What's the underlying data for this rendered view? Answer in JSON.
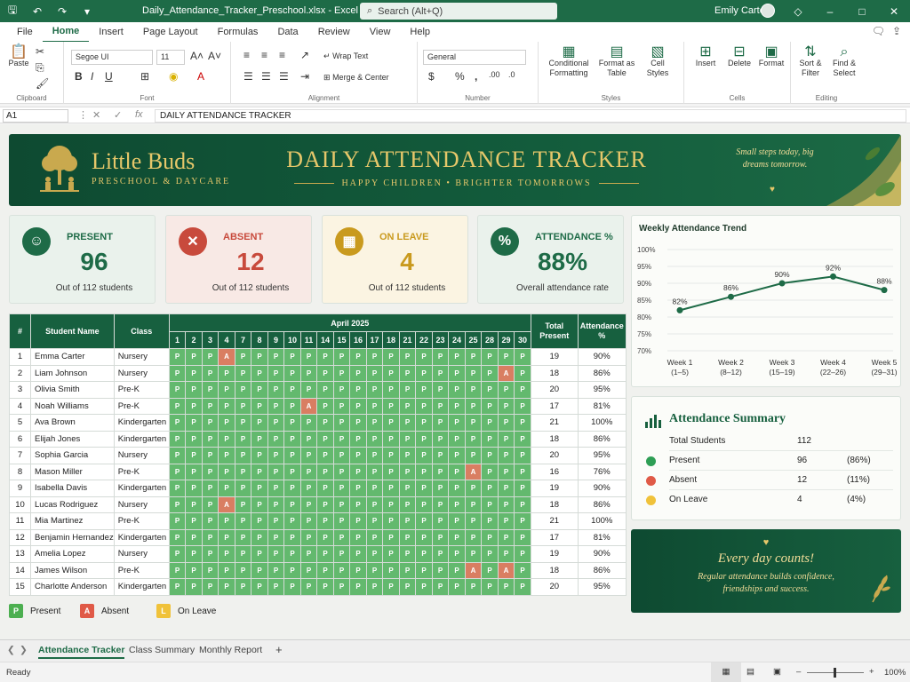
{
  "titlebar": {
    "filename": "Daily_Attendance_Tracker_Preschool.xlsx",
    "app_suffix": "- Excel",
    "search_placeholder": "Search (Alt+Q)",
    "user": "Emily Carter"
  },
  "menu": [
    "File",
    "Home",
    "Insert",
    "Page Layout",
    "Formulas",
    "Data",
    "Review",
    "View",
    "Help"
  ],
  "ribbon": {
    "paste": "Paste",
    "clipboard": "Clipboard",
    "font_name": "Segoe UI",
    "font_size": "11",
    "font": "Font",
    "wrap_text": "Wrap Text",
    "merge_center": "Merge & Center",
    "alignment": "Alignment",
    "number_format": "General",
    "number": "Number",
    "conditional_formatting": "Conditional Formatting",
    "format_as_table": "Format as Table",
    "cell_styles": "Cell Styles",
    "styles": "Styles",
    "insert": "Insert",
    "delete": "Delete",
    "format": "Format",
    "cells": "Cells",
    "sort_filter": "Sort & Filter",
    "find_select": "Find & Select",
    "editing": "Editing"
  },
  "formula_bar": {
    "name_box": "A1",
    "fx": "fx",
    "content": "DAILY ATTENDANCE TRACKER"
  },
  "banner": {
    "brand": "Little Buds",
    "brand_sub": "PRESCHOOL & DAYCARE",
    "title": "DAILY ATTENDANCE TRACKER",
    "subtitle": "HAPPY CHILDREN • BRIGHTER TOMORROWS",
    "quote": "Small steps today, big dreams tomorrow."
  },
  "kpis": [
    {
      "label": "PRESENT",
      "value": "96",
      "sub": "Out of 112 students",
      "color": "#1e6b47",
      "bg": "#eaf2ec"
    },
    {
      "label": "ABSENT",
      "value": "12",
      "sub": "Out of 112 students",
      "color": "#c84a3c",
      "bg": "#f8e9e5"
    },
    {
      "label": "ON LEAVE",
      "value": "4",
      "sub": "Out of 112 students",
      "color": "#c99a1e",
      "bg": "#fbf4e2"
    },
    {
      "label": "ATTENDANCE %",
      "value": "88%",
      "sub": "Overall attendance rate",
      "color": "#1e6b47",
      "bg": "#eaf2ec"
    }
  ],
  "tracker": {
    "headers": {
      "num": "#",
      "name": "Student Name",
      "class": "Class",
      "month": "April 2025",
      "total": "Total Present",
      "pct": "Attendance %"
    },
    "days": [
      "1",
      "2",
      "3",
      "4",
      "7",
      "8",
      "9",
      "10",
      "11",
      "14",
      "15",
      "16",
      "17",
      "18",
      "21",
      "22",
      "23",
      "24",
      "25",
      "28",
      "29",
      "30"
    ],
    "students": [
      {
        "n": "1",
        "name": "Emma Carter",
        "class": "Nursery",
        "marks": "PPPAPPPPPPPPPPPPPPPPPP",
        "total": "19",
        "pct": "90%"
      },
      {
        "n": "2",
        "name": "Liam Johnson",
        "class": "Nursery",
        "marks": "PPPPPPPPPPPPPPPPPPPPAP",
        "total": "18",
        "pct": "86%"
      },
      {
        "n": "3",
        "name": "Olivia Smith",
        "class": "Pre-K",
        "marks": "PPPPPPPPPPPPPPPPPPPPPP",
        "total": "20",
        "pct": "95%"
      },
      {
        "n": "4",
        "name": "Noah Williams",
        "class": "Pre-K",
        "marks": "PPPPPPPPAPPPPPPPPPPPPP",
        "total": "17",
        "pct": "81%"
      },
      {
        "n": "5",
        "name": "Ava Brown",
        "class": "Kindergarten",
        "marks": "PPPPPPPPPPPPPPPPPPPPPP",
        "total": "21",
        "pct": "100%"
      },
      {
        "n": "6",
        "name": "Elijah Jones",
        "class": "Kindergarten",
        "marks": "PPPPPPPPPPPPPPPPPPPPPP",
        "total": "18",
        "pct": "86%"
      },
      {
        "n": "7",
        "name": "Sophia Garcia",
        "class": "Nursery",
        "marks": "PPPPPPPPPPPPPPPPPPPPPP",
        "total": "20",
        "pct": "95%"
      },
      {
        "n": "8",
        "name": "Mason Miller",
        "class": "Pre-K",
        "marks": "PPPPPPPPPPPPPPPPPPAPPP",
        "total": "16",
        "pct": "76%"
      },
      {
        "n": "9",
        "name": "Isabella Davis",
        "class": "Kindergarten",
        "marks": "PPPPPPPPPPPPPPPPPPPPPP",
        "total": "19",
        "pct": "90%"
      },
      {
        "n": "10",
        "name": "Lucas Rodriguez",
        "class": "Nursery",
        "marks": "PPPAPPPPPPPPPPPPPPPPPP",
        "total": "18",
        "pct": "86%"
      },
      {
        "n": "11",
        "name": "Mia Martinez",
        "class": "Pre-K",
        "marks": "PPPPPPPPPPPPPPPPPPPPPP",
        "total": "21",
        "pct": "100%"
      },
      {
        "n": "12",
        "name": "Benjamin Hernandez",
        "class": "Kindergarten",
        "marks": "PPPPPPPPPPPPPPPPPPPPPP",
        "total": "17",
        "pct": "81%"
      },
      {
        "n": "13",
        "name": "Amelia Lopez",
        "class": "Nursery",
        "marks": "PPPPPPPPPPPPPPPPPPPPPP",
        "total": "19",
        "pct": "90%"
      },
      {
        "n": "14",
        "name": "James Wilson",
        "class": "Pre-K",
        "marks": "PPPPPPPPPPPPPPPPPPAPAP",
        "total": "18",
        "pct": "86%"
      },
      {
        "n": "15",
        "name": "Charlotte Anderson",
        "class": "Kindergarten",
        "marks": "PPPPPPPPPPPPPPPPPPPPPP",
        "total": "20",
        "pct": "95%"
      }
    ],
    "legend": [
      {
        "code": "P",
        "label": "Present",
        "color": "#4caf50"
      },
      {
        "code": "A",
        "label": "Absent",
        "color": "#e05a47"
      },
      {
        "code": "L",
        "label": "On Leave",
        "color": "#f0c23a"
      }
    ]
  },
  "chart_data": {
    "type": "line",
    "title": "Weekly Attendance Trend",
    "categories": [
      "Week 1 (1–5)",
      "Week 2 (8–12)",
      "Week 3 (15–19)",
      "Week 4 (22–26)",
      "Week 5 (29–31)"
    ],
    "cat_line1": [
      "Week 1",
      "Week 2",
      "Week 3",
      "Week 4",
      "Week 5"
    ],
    "cat_line2": [
      "(1–5)",
      "(8–12)",
      "(15–19)",
      "(22–26)",
      "(29–31)"
    ],
    "values": [
      82,
      86,
      90,
      92,
      88
    ],
    "value_labels": [
      "82%",
      "86%",
      "90%",
      "92%",
      "88%"
    ],
    "yticks": [
      "100%",
      "95%",
      "90%",
      "85%",
      "80%",
      "75%",
      "70%"
    ],
    "ylim": [
      70,
      100
    ],
    "grid": true,
    "line_color": "#1e6b47"
  },
  "summary": {
    "title": "Attendance Summary",
    "total_label": "Total Students",
    "total_value": "112",
    "rows": [
      {
        "label": "Present",
        "value": "96",
        "pct": "(86%)",
        "color": "#2e9e55"
      },
      {
        "label": "Absent",
        "value": "12",
        "pct": "(11%)",
        "color": "#e05a47"
      },
      {
        "label": "On Leave",
        "value": "4",
        "pct": "(4%)",
        "color": "#f0c23a"
      }
    ]
  },
  "quote_card": {
    "headline": "Every day counts!",
    "body": "Regular attendance builds confidence, friendships and success."
  },
  "sheet_tabs": [
    "Attendance Tracker",
    "Class Summary",
    "Monthly Report"
  ],
  "status": {
    "ready": "Ready",
    "zoom": "100%"
  }
}
